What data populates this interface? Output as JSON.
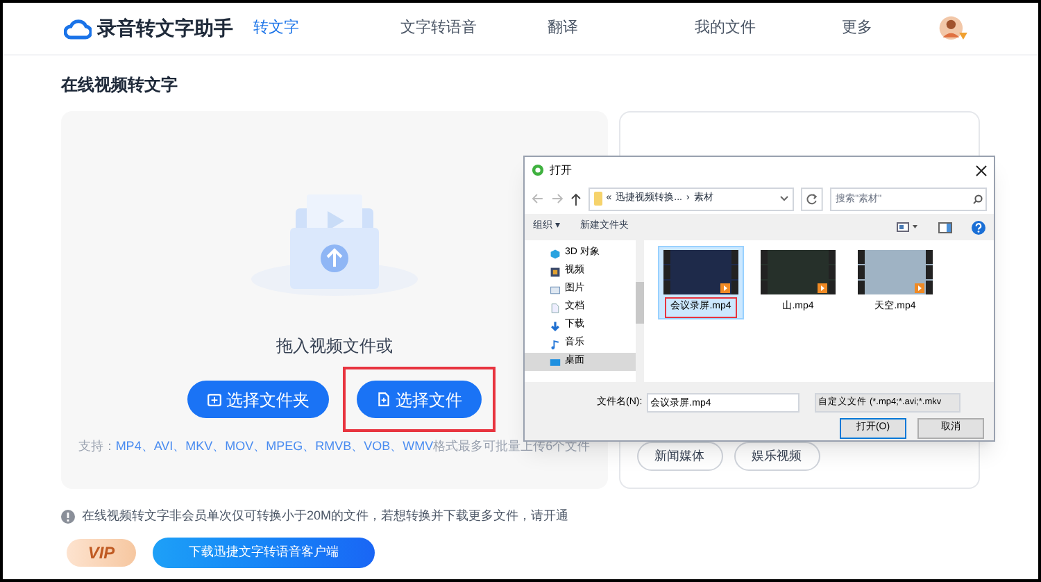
{
  "app": {
    "name": "录音转文字助手"
  },
  "nav": [
    {
      "label": "转文字",
      "selected": true
    },
    {
      "label": "文字转语音",
      "selected": false
    },
    {
      "label": "翻译",
      "selected": false
    },
    {
      "label": "我的文件",
      "selected": false
    },
    {
      "label": "更多",
      "selected": false
    }
  ],
  "page_title": "在线视频转文字",
  "upload": {
    "prompt": "拖入视频文件或",
    "buttons": [
      {
        "label": "选择文件夹",
        "kind": "folder",
        "highlighted": false
      },
      {
        "label": "选择文件",
        "kind": "file",
        "highlighted": true
      }
    ],
    "support_label": "支持：",
    "formats": "MP4、AVI、MKV、MOV、MPEG、RMVB、VOB、WMV",
    "support_suffix": "格式最多可批量上传6个文件"
  },
  "right_panel": {
    "tags": [
      "新闻媒体",
      "娱乐视频"
    ]
  },
  "dialog": {
    "title": "打开",
    "path": [
      "«",
      "迅捷视频转换...",
      "›",
      "素材"
    ],
    "search": {
      "placeholder": "搜索\"素材\""
    },
    "toolbar": [
      "组织 ▾",
      "新建文件夹"
    ],
    "places": [
      {
        "label": "3D 对象",
        "kind": "cube",
        "selected": false
      },
      {
        "label": "视频",
        "kind": "video",
        "selected": false
      },
      {
        "label": "图片",
        "kind": "picture",
        "selected": false
      },
      {
        "label": "文档",
        "kind": "document",
        "selected": false
      },
      {
        "label": "下载",
        "kind": "download",
        "selected": false
      },
      {
        "label": "音乐",
        "kind": "music",
        "selected": false
      },
      {
        "label": "桌面",
        "kind": "desktop",
        "selected": true
      }
    ],
    "files": [
      {
        "name": "会议录屏.mp4",
        "selected": true,
        "highlighted": true,
        "color": "#1e2a4a"
      },
      {
        "name": "山.mp4",
        "selected": false,
        "highlighted": false,
        "color": "#26302a"
      },
      {
        "name": "天空.mp4",
        "selected": false,
        "highlighted": false,
        "color": "#9fb3c4"
      }
    ],
    "filename_label": "文件名(N):",
    "filename": "会议录屏.mp4",
    "filter": "自定义文件 (*.mp4;*.avi;*.mkv",
    "buttons": [
      "打开(O)",
      "取消"
    ]
  },
  "notice": "在线视频转文字非会员单次仅可转换小于20M的文件，若想转换并下载更多文件，请开通",
  "vip_badge": "VIP",
  "download_button": "下载迅捷文字转语音客户端"
}
